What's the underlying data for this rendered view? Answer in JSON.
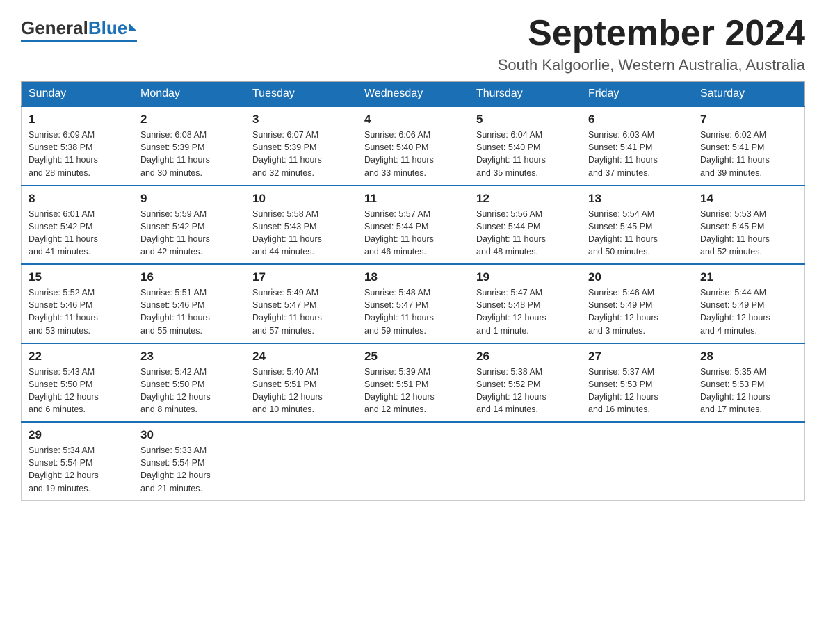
{
  "logo": {
    "general": "General",
    "blue": "Blue"
  },
  "title": "September 2024",
  "location": "South Kalgoorlie, Western Australia, Australia",
  "weekdays": [
    "Sunday",
    "Monday",
    "Tuesday",
    "Wednesday",
    "Thursday",
    "Friday",
    "Saturday"
  ],
  "weeks": [
    [
      {
        "day": 1,
        "sunrise": "6:09 AM",
        "sunset": "5:38 PM",
        "daylight": "11 hours and 28 minutes."
      },
      {
        "day": 2,
        "sunrise": "6:08 AM",
        "sunset": "5:39 PM",
        "daylight": "11 hours and 30 minutes."
      },
      {
        "day": 3,
        "sunrise": "6:07 AM",
        "sunset": "5:39 PM",
        "daylight": "11 hours and 32 minutes."
      },
      {
        "day": 4,
        "sunrise": "6:06 AM",
        "sunset": "5:40 PM",
        "daylight": "11 hours and 33 minutes."
      },
      {
        "day": 5,
        "sunrise": "6:04 AM",
        "sunset": "5:40 PM",
        "daylight": "11 hours and 35 minutes."
      },
      {
        "day": 6,
        "sunrise": "6:03 AM",
        "sunset": "5:41 PM",
        "daylight": "11 hours and 37 minutes."
      },
      {
        "day": 7,
        "sunrise": "6:02 AM",
        "sunset": "5:41 PM",
        "daylight": "11 hours and 39 minutes."
      }
    ],
    [
      {
        "day": 8,
        "sunrise": "6:01 AM",
        "sunset": "5:42 PM",
        "daylight": "11 hours and 41 minutes."
      },
      {
        "day": 9,
        "sunrise": "5:59 AM",
        "sunset": "5:42 PM",
        "daylight": "11 hours and 42 minutes."
      },
      {
        "day": 10,
        "sunrise": "5:58 AM",
        "sunset": "5:43 PM",
        "daylight": "11 hours and 44 minutes."
      },
      {
        "day": 11,
        "sunrise": "5:57 AM",
        "sunset": "5:44 PM",
        "daylight": "11 hours and 46 minutes."
      },
      {
        "day": 12,
        "sunrise": "5:56 AM",
        "sunset": "5:44 PM",
        "daylight": "11 hours and 48 minutes."
      },
      {
        "day": 13,
        "sunrise": "5:54 AM",
        "sunset": "5:45 PM",
        "daylight": "11 hours and 50 minutes."
      },
      {
        "day": 14,
        "sunrise": "5:53 AM",
        "sunset": "5:45 PM",
        "daylight": "11 hours and 52 minutes."
      }
    ],
    [
      {
        "day": 15,
        "sunrise": "5:52 AM",
        "sunset": "5:46 PM",
        "daylight": "11 hours and 53 minutes."
      },
      {
        "day": 16,
        "sunrise": "5:51 AM",
        "sunset": "5:46 PM",
        "daylight": "11 hours and 55 minutes."
      },
      {
        "day": 17,
        "sunrise": "5:49 AM",
        "sunset": "5:47 PM",
        "daylight": "11 hours and 57 minutes."
      },
      {
        "day": 18,
        "sunrise": "5:48 AM",
        "sunset": "5:47 PM",
        "daylight": "11 hours and 59 minutes."
      },
      {
        "day": 19,
        "sunrise": "5:47 AM",
        "sunset": "5:48 PM",
        "daylight": "12 hours and 1 minute."
      },
      {
        "day": 20,
        "sunrise": "5:46 AM",
        "sunset": "5:49 PM",
        "daylight": "12 hours and 3 minutes."
      },
      {
        "day": 21,
        "sunrise": "5:44 AM",
        "sunset": "5:49 PM",
        "daylight": "12 hours and 4 minutes."
      }
    ],
    [
      {
        "day": 22,
        "sunrise": "5:43 AM",
        "sunset": "5:50 PM",
        "daylight": "12 hours and 6 minutes."
      },
      {
        "day": 23,
        "sunrise": "5:42 AM",
        "sunset": "5:50 PM",
        "daylight": "12 hours and 8 minutes."
      },
      {
        "day": 24,
        "sunrise": "5:40 AM",
        "sunset": "5:51 PM",
        "daylight": "12 hours and 10 minutes."
      },
      {
        "day": 25,
        "sunrise": "5:39 AM",
        "sunset": "5:51 PM",
        "daylight": "12 hours and 12 minutes."
      },
      {
        "day": 26,
        "sunrise": "5:38 AM",
        "sunset": "5:52 PM",
        "daylight": "12 hours and 14 minutes."
      },
      {
        "day": 27,
        "sunrise": "5:37 AM",
        "sunset": "5:53 PM",
        "daylight": "12 hours and 16 minutes."
      },
      {
        "day": 28,
        "sunrise": "5:35 AM",
        "sunset": "5:53 PM",
        "daylight": "12 hours and 17 minutes."
      }
    ],
    [
      {
        "day": 29,
        "sunrise": "5:34 AM",
        "sunset": "5:54 PM",
        "daylight": "12 hours and 19 minutes."
      },
      {
        "day": 30,
        "sunrise": "5:33 AM",
        "sunset": "5:54 PM",
        "daylight": "12 hours and 21 minutes."
      },
      null,
      null,
      null,
      null,
      null
    ]
  ],
  "labels": {
    "sunrise": "Sunrise:",
    "sunset": "Sunset:",
    "daylight": "Daylight:"
  }
}
